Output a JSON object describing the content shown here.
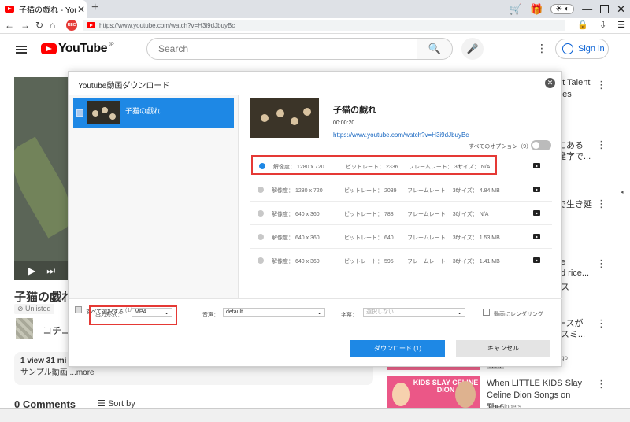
{
  "browser": {
    "tab_title": "子猫の戯れ - YouTu",
    "url": "https://www.youtube.com/watch?v=H3i9dJbuyBc",
    "rec_label": "REC"
  },
  "youtube": {
    "logo_text": "YouTube",
    "logo_region": "JP",
    "search_placeholder": "Search",
    "signin_label": "Sign in",
    "video_title": "子猫の戯れ",
    "unlisted_label": "Unlisted",
    "channel_name": "コチニ",
    "desc_line1": "1 view  31 mi",
    "desc_line2": "サンプル動画 ...more",
    "comments_label": "0 Comments",
    "sort_label": "Sort by",
    "side_items": [
      {
        "text": "ot Talent"
      },
      {
        "text": "ges"
      },
      {
        "text": "にある"
      },
      {
        "text": "逢字で..."
      },
      {
        "text": "で生き延"
      },
      {
        "text": "e"
      },
      {
        "text": "d rice..."
      },
      {
        "text": "ス"
      },
      {
        "text": "ースが"
      },
      {
        "text": "\"スミ..."
      }
    ],
    "side_meta": "go",
    "new_badge": "New",
    "rec_thumb_text": "KIDS SLAY CELINE DION",
    "rec_title": "When LITTLE KIDS Slay Celine Dion Songs on The...",
    "rec_channel": "Star Singers"
  },
  "dialog": {
    "title": "Youtube動画ダウンロード",
    "item_name": "子猫の戯れ",
    "select_all": "すべて選択する",
    "select_count": "(1/1)",
    "video_title": "子猫の戯れ",
    "duration": "00:00:20",
    "url": "https://www.youtube.com/watch?v=H3i9dJbuyBc",
    "all_options": "すべてのオプション（9）",
    "rows": [
      {
        "res": "解像度： 1280 x 720",
        "bitrate": "ビットレート： 2336",
        "fps": "フレームレート： 30",
        "size": "サイズ： N/A"
      },
      {
        "res": "解像度： 1280 x 720",
        "bitrate": "ビットレート： 2039",
        "fps": "フレームレート： 30",
        "size": "サイズ： 4.84 MB"
      },
      {
        "res": "解像度： 640 x 360",
        "bitrate": "ビットレート： 788",
        "fps": "フレームレート： 30",
        "size": "サイズ： N/A"
      },
      {
        "res": "解像度： 640 x 360",
        "bitrate": "ビットレート： 640",
        "fps": "フレームレート： 30",
        "size": "サイズ： 1.53 MB"
      },
      {
        "res": "解像度： 640 x 360",
        "bitrate": "ビットレート： 595",
        "fps": "フレームレート： 30",
        "size": "サイズ： 1.41 MB"
      }
    ],
    "format_label": "出力形式：",
    "format_value": "MP4",
    "audio_label": "音声：",
    "audio_value": "default",
    "subtitle_label": "字幕：",
    "subtitle_value": "選択しない",
    "render_label": "動画にレンダリング",
    "download_button": "ダウンロード (1)",
    "cancel_button": "キャンセル"
  },
  "colors": {
    "accent": "#1e88e5",
    "highlight": "#e53935",
    "youtube_red": "#ff0000"
  }
}
